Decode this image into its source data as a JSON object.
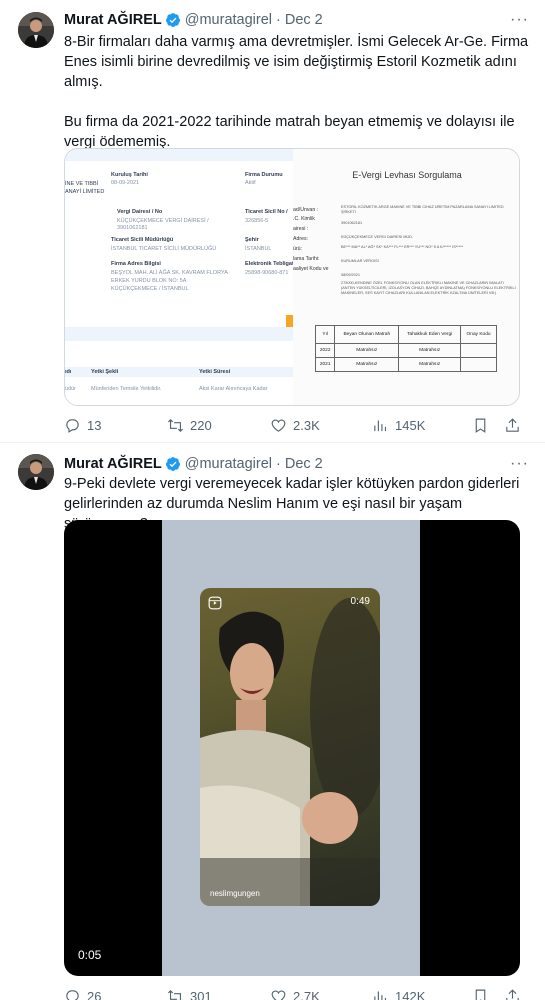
{
  "tweets": [
    {
      "author_name": "Murat AĞIREL",
      "handle": "@muratagirel",
      "date": "Dec 2",
      "more_glyph": "···",
      "text": "8-Bir firmaları daha varmış ama devretmişler. İsmi Gelecek Ar-Ge. Firma Enes isimli birine devredilmiş ve isim değiştirmiş Estoril Kozmetik adını almış.\n\nBu firma da 2021-2022 tarihinde matrah beyan etmemiş ve dolayısı ile vergi ödememiş.",
      "stats": {
        "replies": "13",
        "retweets": "220",
        "likes": "2.3K",
        "views": "145K"
      },
      "media": {
        "left_panel": {
          "kurulus_label": "Kuruluş Tarihi",
          "kurulus_value": "08-09-2021",
          "firma_durumu_label": "Firma Durumu",
          "firma_durumu_value": "Aktif",
          "name_fragment_1": "İNE VE TIBBİ",
          "name_fragment_2": "ANAYİ LİMİTED",
          "vergi_dairesi_label": "Vergi Dairesi / No",
          "vergi_dairesi_value": "KÜÇÜKÇEKMECE VERGİ DAİRESİ / 3901062181",
          "ticaret_sicil_no_label": "Ticaret Sicil No /",
          "ticaret_sicil_no_value": "326856-5",
          "ticaret_sicil_mudurlugu_label": "Ticaret Sicili Müdürlüğü",
          "ticaret_sicil_mudurlugu_value": "İSTANBUL TİCARET SİCİLİ MÜDÜRLÜĞÜ",
          "sehir_label": "Şehir",
          "sehir_value": "İSTANBUL",
          "adres_label": "Firma Adres Bilgisi",
          "adres_value_1": "BEŞYOL MAH. ALİ AĞA SK. KAVRAM FLORYA",
          "adres_value_2": "ERKEK YURDU BLOK NO: 5A",
          "adres_value_3": "KÜÇÜKÇEKMECE / İSTANBUL",
          "elektronik_label": "Elektronik Tebligat",
          "elektronik_value": "25898-90680-871",
          "col_1": "ıdı",
          "col_2": "Yetki Şekli",
          "col_3": "Yetki Süresi",
          "row_1": "üdür",
          "row_2": "Münferiden Temsile Yetkilidir.",
          "row_3": "Aksi Karar Alınıncaya Kadar"
        },
        "right_panel": {
          "title": "E-Vergi Levhası Sorgulama",
          "labels": [
            "ad/Unvan :",
            ".C. Kimlik",
            "airesi :",
            "Adres:",
            "ürü:",
            "lama Tarihi:",
            "aaliyet Kodu ve"
          ],
          "small_1": "ESTORİL KOZMETİK ARGE MAKİNE VE TIBBİ CİHAZ ÜRETİM PAZARLAMA SANAYİ LİMİTED ŞİRKETİ",
          "small_2": "3901062181",
          "small_3": "KÜÇÜKÇEKMECE VERGİ DAİRESİ MÜD.",
          "small_4": "BE*** MA** AL* AĞ* SK* KA*** FL*** ER*** YU*** NO* 5 A K/*****  İS*****",
          "small_5": "KURUMLAR VERGİSİ",
          "small_6": "08/09/2021",
          "small_7": "275000-KENDİNE ÖZEL FONKSİYONU OLAN ELEKTRİKLİ MAKİNE VE CİHAZLARIN İMALATI (ANTEN YÜKSELTİCİLERİ, İZOLASYON CİHAZI, BAHÇE AYDINLATMA) FONKSİYONLU ELEKTRİKLİ MAKİNELER, SES KAYIT CİHAZLARI KULLANILAN ELEKTRİK KZALTMA ÜNİTELERİ VB.)",
          "table_headers": [
            "Yıl",
            "Beyan Olunan Matrah",
            "Tahakkuk Eden Vergi",
            "Onay Kodu"
          ],
          "table_rows": [
            [
              "2022",
              "Matrahsız",
              "Matrahsız",
              ""
            ],
            [
              "2021",
              "Matrahsız",
              "Matrahsız",
              ""
            ]
          ]
        }
      }
    },
    {
      "author_name": "Murat AĞIREL",
      "handle": "@muratagirel",
      "date": "Dec 2",
      "more_glyph": "···",
      "text": "9-Peki devlete vergi veremeyecek kadar işler kötüyken pardon giderleri gelirlerinden az durumda Neslim Hanım ve eşi nasıl bir yaşam sürüyormuş?",
      "stats": {
        "replies": "26",
        "retweets": "301",
        "likes": "2.7K",
        "views": "142K"
      },
      "media": {
        "reel_time": "0:49",
        "reel_user": "neslimgungen",
        "video_time": "0:05"
      }
    }
  ],
  "colors": {
    "verified": "#1d9bf0",
    "muted": "#536471",
    "text": "#0f1419"
  }
}
